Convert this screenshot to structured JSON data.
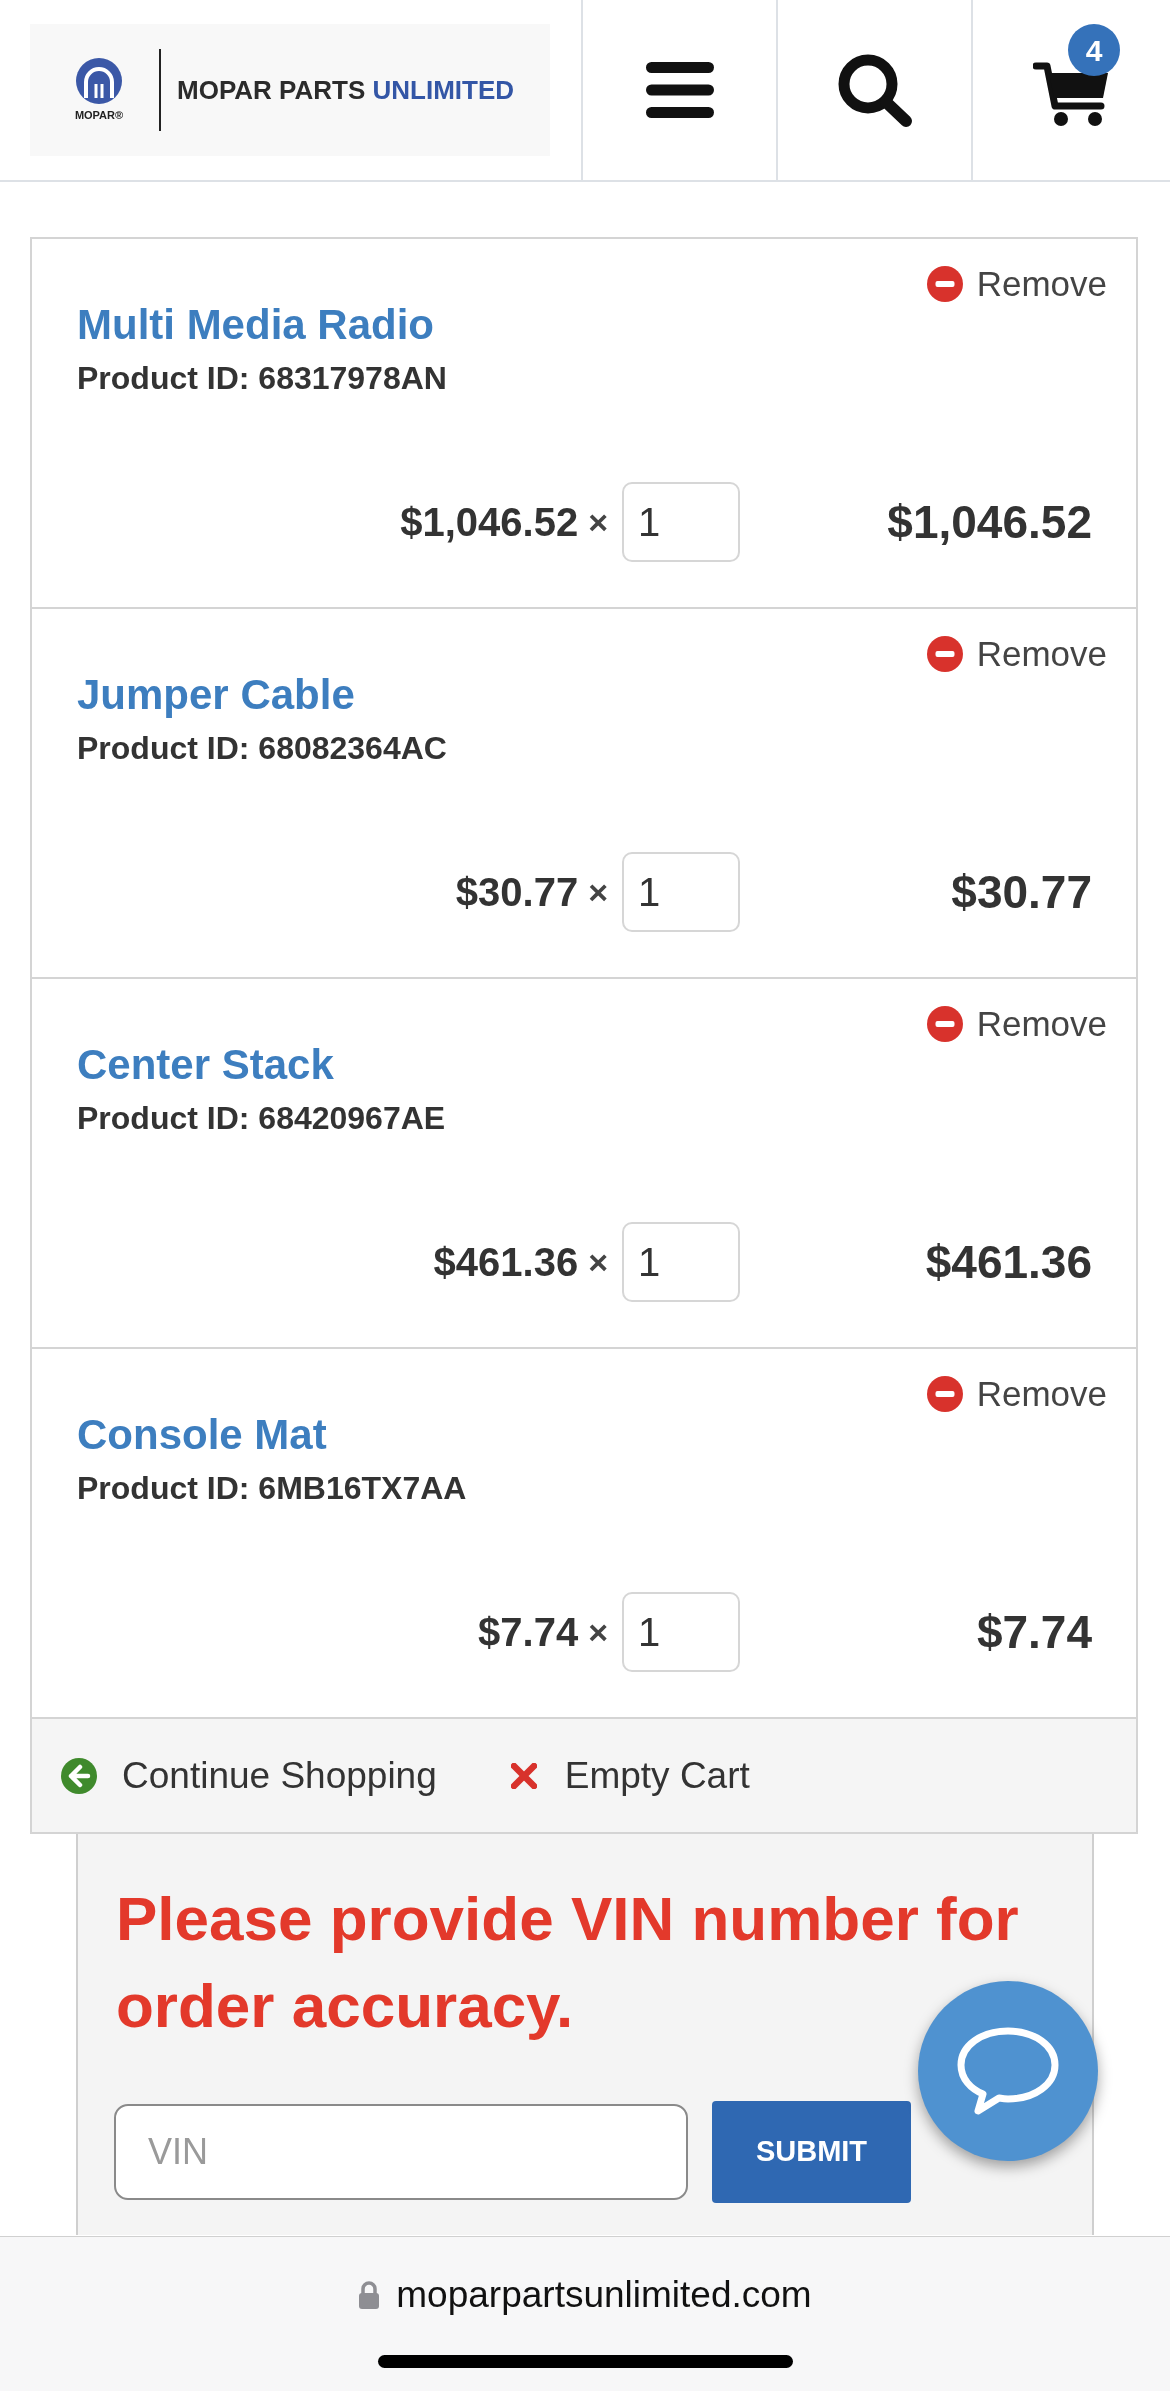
{
  "header": {
    "logo": {
      "emblem_text": "MOPAR®",
      "title": "MOPAR PARTS",
      "title_accent": "UNLIMITED"
    },
    "cart_count": "4"
  },
  "cart": {
    "items": [
      {
        "name": "Multi Media Radio",
        "product_id": "Product ID: 68317978AN",
        "remove_label": "Remove",
        "unit_price": "$1,046.52",
        "times": "×",
        "quantity": "1",
        "total": "$1,046.52"
      },
      {
        "name": "Jumper Cable",
        "product_id": "Product ID: 68082364AC",
        "remove_label": "Remove",
        "unit_price": "$30.77",
        "times": "×",
        "quantity": "1",
        "total": "$30.77"
      },
      {
        "name": "Center Stack",
        "product_id": "Product ID: 68420967AE",
        "remove_label": "Remove",
        "unit_price": "$461.36",
        "times": "×",
        "quantity": "1",
        "total": "$461.36"
      },
      {
        "name": "Console Mat",
        "product_id": "Product ID: 6MB16TX7AA",
        "remove_label": "Remove",
        "unit_price": "$7.74",
        "times": "×",
        "quantity": "1",
        "total": "$7.74"
      }
    ],
    "actions": [
      {
        "kind": "continue",
        "label": "Continue Shopping"
      },
      {
        "kind": "empty",
        "label": "Empty Cart"
      }
    ]
  },
  "vin_panel": {
    "heading": "Please provide VIN number for order accuracy.",
    "input": {
      "placeholder": "VIN"
    },
    "submit": "SUBMIT"
  },
  "browser_bar": {
    "url": "moparpartsunlimited.com"
  }
}
